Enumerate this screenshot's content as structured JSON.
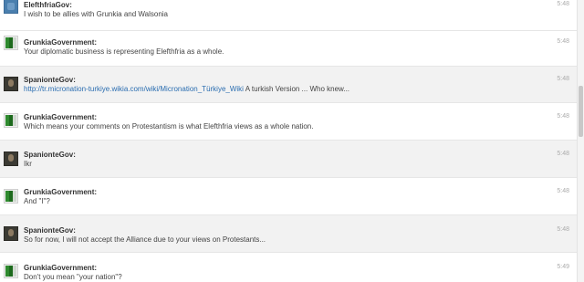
{
  "messages": [
    {
      "sender": "ElefthfriaGov:",
      "text": "I wish to be allies with Grunkia and Walsonia",
      "time": "5:48",
      "avatar": "blue-square-icon"
    },
    {
      "sender": "GrunkiaGovernment:",
      "text": "Your diplomatic business is representing Elefthfria as a whole.",
      "time": "5:48",
      "avatar": "green-flag-icon"
    },
    {
      "sender": "SpanionteGov:",
      "link": "http://tr.micronation-turkiye.wikia.com/wiki/Micronation_Türkiye_Wiki",
      "text": " A turkish Version ... Who knew...",
      "time": "5:48",
      "avatar": "portrait-icon"
    },
    {
      "sender": "GrunkiaGovernment:",
      "text": "Which means your comments on Protestantism is what Elefthfria views as a whole nation.",
      "time": "5:48",
      "avatar": "green-flag-icon"
    },
    {
      "sender": "SpanionteGov:",
      "text": "Ikr",
      "time": "5:48",
      "avatar": "portrait-icon"
    },
    {
      "sender": "GrunkiaGovernment:",
      "text": "And \"I\"?",
      "time": "5:48",
      "avatar": "green-flag-icon"
    },
    {
      "sender": "SpanionteGov:",
      "text": "So for now, I will not accept the Alliance due to your views on Protestants...",
      "time": "5:48",
      "avatar": "portrait-icon"
    },
    {
      "sender": "GrunkiaGovernment:",
      "text": "Don't you mean \"your nation\"?",
      "time": "5:49",
      "avatar": "green-flag-icon"
    }
  ],
  "colors": {
    "alt_row": "#f2f2f2",
    "link": "#2a6db0",
    "timestamp": "#aaaaaa"
  }
}
